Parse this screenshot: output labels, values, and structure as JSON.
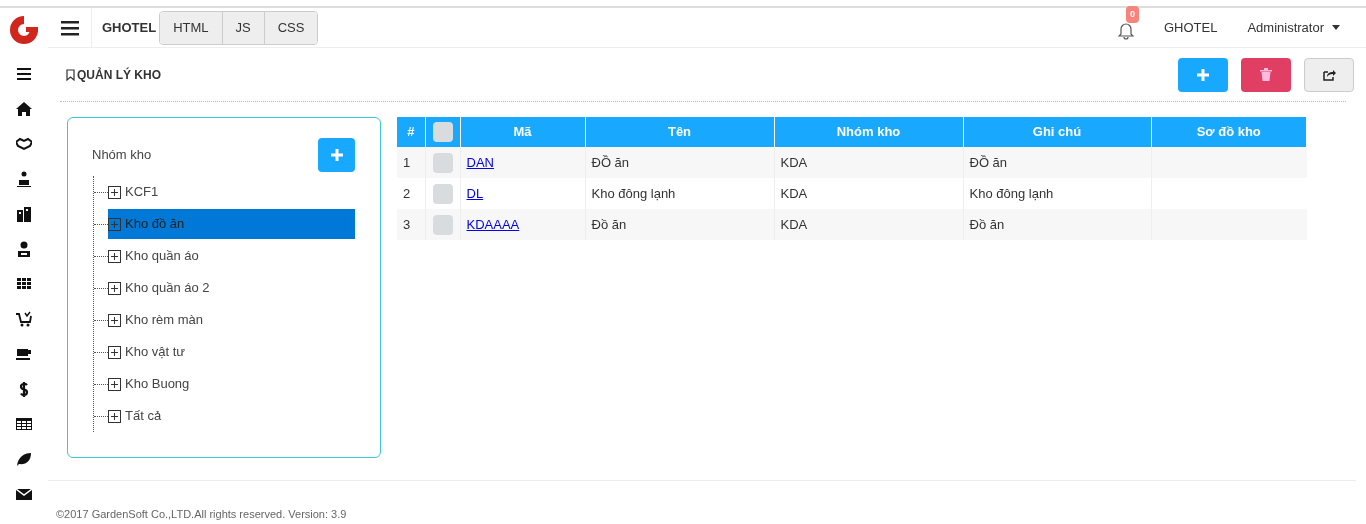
{
  "header": {
    "brand": "GHOTEL",
    "tabs": [
      "HTML",
      "JS",
      "CSS"
    ],
    "notification_count": "0",
    "organization": "GHOTEL",
    "user": "Administrator"
  },
  "page_title": "QUẢN LÝ KHO",
  "tree": {
    "title": "Nhóm kho",
    "items": [
      {
        "label": "KCF1",
        "selected": false
      },
      {
        "label": "Kho đồ ăn",
        "selected": true
      },
      {
        "label": "Kho quần áo",
        "selected": false
      },
      {
        "label": "Kho quần áo 2",
        "selected": false
      },
      {
        "label": "Kho rèm màn",
        "selected": false
      },
      {
        "label": "Kho vật tư",
        "selected": false
      },
      {
        "label": "Kho Buong",
        "selected": false
      },
      {
        "label": "Tất cả",
        "selected": false
      }
    ]
  },
  "table": {
    "select_all_checked": false,
    "columns": [
      "#",
      "Mã",
      "Tên",
      "Nhóm kho",
      "Ghi chú",
      "Sơ đồ kho"
    ],
    "rows": [
      {
        "number": "1",
        "checked": false,
        "code": "DAN",
        "name": "ĐỒ ăn",
        "group": "KDA",
        "note": "ĐỒ ăn"
      },
      {
        "number": "2",
        "checked": false,
        "code": "DL",
        "name": "Kho đông lạnh",
        "group": "KDA",
        "note": "Kho đông lạnh"
      },
      {
        "number": "3",
        "checked": false,
        "code": "KDAAAA",
        "name": "Đồ ăn",
        "group": "KDA",
        "note": "Đồ ăn"
      }
    ]
  },
  "footer": "©2017 GardenSoft Co.,LTD.All rights reserved. Version: 3.9"
}
